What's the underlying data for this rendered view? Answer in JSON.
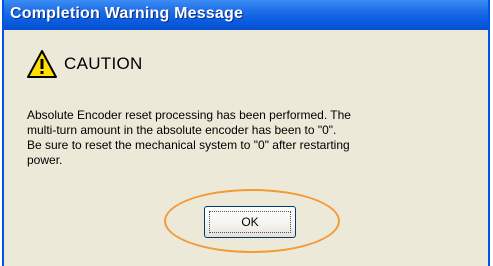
{
  "dialog": {
    "title": "Completion Warning Message",
    "caution_icon": "warning-triangle-icon",
    "caution_label": "CAUTION",
    "message_lines": [
      "Absolute Encoder reset processing has been performed. The",
      "multi-turn amount in the absolute encoder has been to \"0\".",
      "Be sure to reset the mechanical system to \"0\" after restarting",
      "power."
    ],
    "ok_label": "OK"
  },
  "colors": {
    "titlebar": "#0a5ce0",
    "window_bg": "#ece9d8",
    "highlight_ring": "#f39a35",
    "warning_yellow": "#ffde00"
  }
}
